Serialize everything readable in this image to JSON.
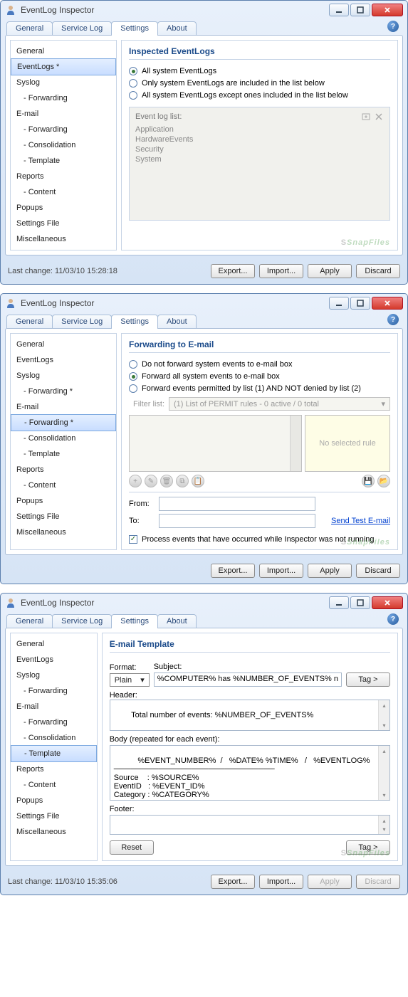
{
  "app_title": "EventLog Inspector",
  "tabs": [
    "General",
    "Service Log",
    "Settings",
    "About"
  ],
  "nav_base": [
    "General",
    "EventLogs",
    "Syslog",
    "Forwarding",
    "E-mail",
    "Forwarding",
    "Consolidation",
    "Template",
    "Reports",
    "Content",
    "Popups",
    "Settings File",
    "Miscellaneous"
  ],
  "watermark": "SnapFiles",
  "buttons": {
    "export": "Export...",
    "import": "Import...",
    "apply": "Apply",
    "discard": "Discard",
    "reset": "Reset",
    "tag": "Tag >"
  },
  "win1": {
    "nav_selected": "EventLogs *",
    "section": "Inspected EventLogs",
    "radios": [
      "All system EventLogs",
      "Only system EventLogs are included in the list below",
      "All system EventLogs except ones included in the list below"
    ],
    "loglist_label": "Event log list:",
    "loglist": [
      "Application",
      "HardwareEvents",
      "Security",
      "System"
    ],
    "status": "Last change: 11/03/10 15:28:18"
  },
  "win2": {
    "nav_mods": {
      "forwarding1": "Forwarding *",
      "forwarding2": "Forwarding *"
    },
    "section": "Forwarding to E-mail",
    "radios": [
      "Do not forward system events to e-mail box",
      "Forward all system events to e-mail box",
      "Forward events permitted by list (1) AND NOT denied by list (2)"
    ],
    "filter_label": "Filter list:",
    "filter_combo": "(1) List of PERMIT rules - 0 active / 0 total",
    "no_rule": "No selected rule",
    "from": "From:",
    "to": "To:",
    "send_test": "Send Test E-mail",
    "process_label": "Process events that have occurred while Inspector was not running"
  },
  "win3": {
    "section": "E-mail Template",
    "format_label": "Format:",
    "format_value": "Plain",
    "subject_label": "Subject:",
    "subject_value": "%COMPUTER% has %NUMBER_OF_EVENTS% n",
    "header_label": "Header:",
    "header_value": "Total number of events: %NUMBER_OF_EVENTS%",
    "body_label": "Body (repeated for each event):",
    "body_value": "   %EVENT_NUMBER%  /   %DATE% %TIME%   /   %EVENTLOG%\n─────────────────────────────\nSource    : %SOURCE%\nEventID   : %EVENT_ID%\nCategory : %CATEGORY%",
    "footer_label": "Footer:",
    "status": "Last change: 11/03/10 15:35:06"
  }
}
